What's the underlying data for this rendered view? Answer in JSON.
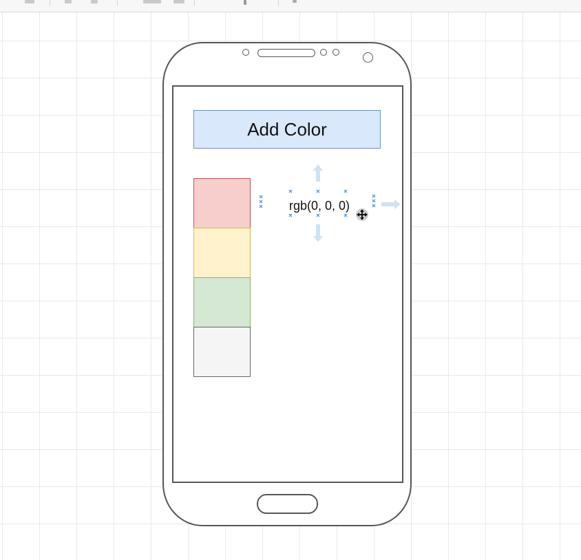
{
  "toolbar": {
    "icons": [
      "format-icon",
      "undo-icon",
      "redo-icon",
      "fill-icon",
      "line-icon",
      "shadow-icon",
      "more-icon"
    ]
  },
  "canvas": {
    "grid": true
  },
  "phone_mockup": {
    "add_color_label": "Add Color",
    "swatches": [
      {
        "name": "red-swatch",
        "fill": "#f8cecc",
        "stroke": "#b85450"
      },
      {
        "name": "yellow-swatch",
        "fill": "#fff2cc",
        "stroke": "#d6b656"
      },
      {
        "name": "green-swatch",
        "fill": "#d5e8d4",
        "stroke": "#82b366"
      },
      {
        "name": "gray-swatch",
        "fill": "#f5f5f5",
        "stroke": "#666666"
      }
    ],
    "selected_label": "rgb(0, 0, 0)"
  },
  "colors": {
    "selection_handle": "#5b9bd5",
    "hover_arrow": "#cfe3f5",
    "outline": "#555555"
  }
}
